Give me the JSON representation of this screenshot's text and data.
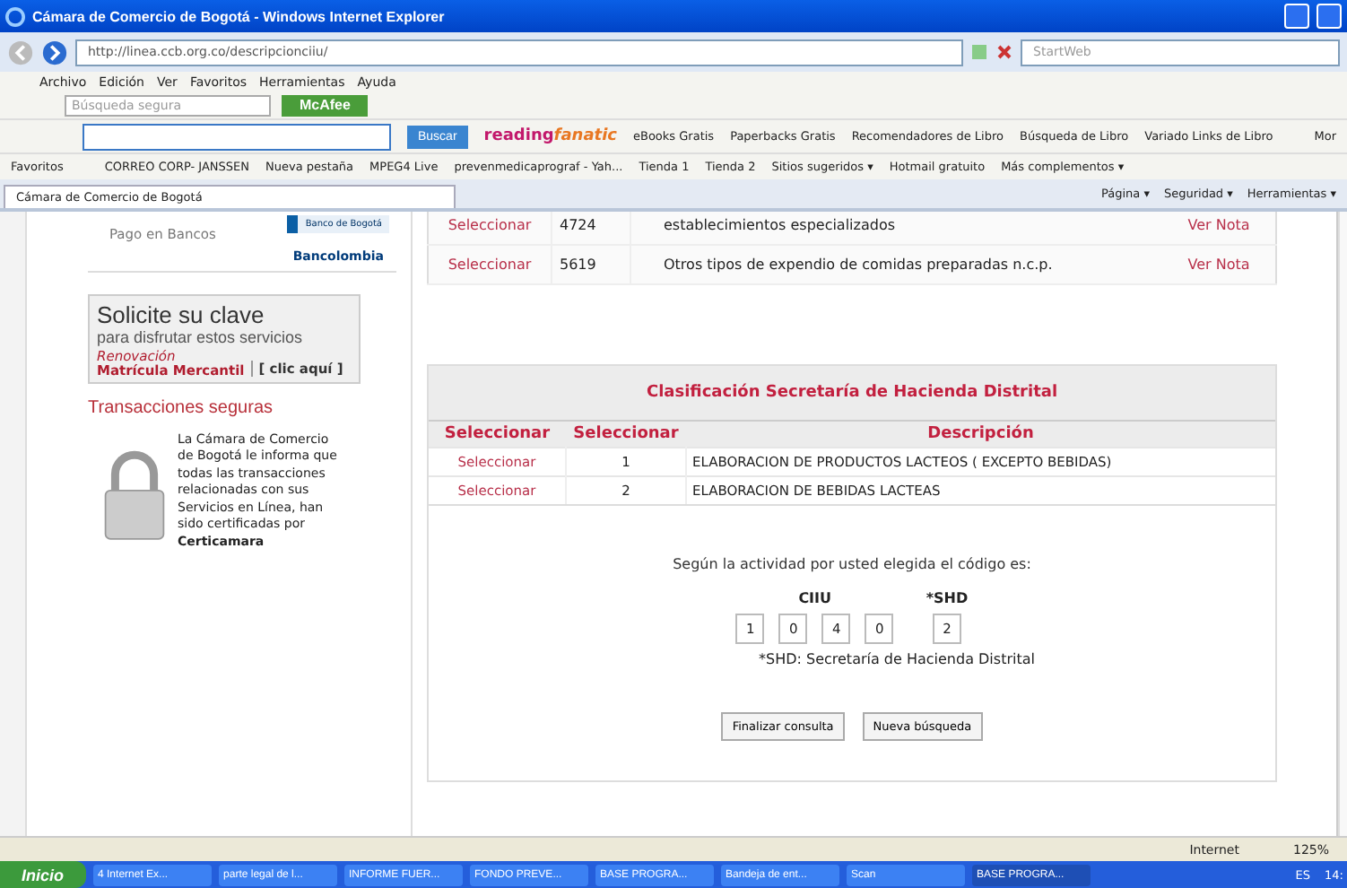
{
  "window": {
    "title": "Cámara de Comercio de Bogotá - Windows Internet Explorer"
  },
  "address_bar": {
    "url": "http://linea.ccb.org.co/descripcionciiu/",
    "search_placeholder": "StartWeb"
  },
  "menu": [
    "Archivo",
    "Edición",
    "Ver",
    "Favoritos",
    "Herramientas",
    "Ayuda"
  ],
  "mcafee_toolbar": {
    "search_placeholder": "Búsqueda segura",
    "brand": "McAfee"
  },
  "book_toolbar": {
    "button": "Buscar",
    "logo_main": "reading",
    "logo_accent": "fanatic",
    "items": [
      "eBooks Gratis",
      "Paperbacks Gratis",
      "Recomendadores de Libro",
      "Búsqueda de Libro",
      "Variado Links de Libro"
    ],
    "more": "Mor"
  },
  "favorites_bar": {
    "label": "Favoritos",
    "items": [
      "CORREO CORP- JANSSEN",
      "Nueva pestaña",
      "MPEG4 Live",
      "prevenmedicaprograf - Yah...",
      "Tienda 1",
      "Tienda 2",
      "Sitios sugeridos ▾",
      "Hotmail gratuito",
      "Más complementos ▾"
    ]
  },
  "tab": {
    "title": "Cámara de Comercio de Bogotá"
  },
  "command_bar": [
    "Página ▾",
    "Seguridad ▾",
    "Herramientas ▾"
  ],
  "sidebar": {
    "payment_label": "Pago en Bancos",
    "banks": [
      "Banco de Bogotá",
      "Bancolombia"
    ],
    "banner": {
      "title": "Solicite su clave",
      "subtitle": "para disfrutar estos servicios",
      "renewal": "Renovación",
      "renewal_strong": "Matrícula Mercantil",
      "link": "[ clic aquí ]"
    },
    "secure_heading": "Transacciones seguras",
    "secure_text": "La Cámara de Comercio de Bogotá le informa que todas las transacciones relacionadas con sus Servicios en Línea, han sido certificadas por **Certicamara**"
  },
  "activity_table": {
    "rows": [
      {
        "action": "Seleccionar",
        "code": "4724",
        "description": "establecimientos especializados",
        "note": "Ver Nota"
      },
      {
        "action": "Seleccionar",
        "code": "5619",
        "description": "Otros tipos de expendio de comidas preparadas n.c.p.",
        "note": "Ver Nota"
      }
    ]
  },
  "shd_table": {
    "title": "Clasificación Secretaría de Hacienda Distrital",
    "columns": [
      "Seleccionar",
      "Seleccionar",
      "Descripción"
    ],
    "rows": [
      {
        "action": "Seleccionar",
        "code": "1",
        "description": "ELABORACION DE PRODUCTOS LACTEOS ( EXCEPTO BEBIDAS)"
      },
      {
        "action": "Seleccionar",
        "code": "2",
        "description": "ELABORACION DE BEBIDAS LACTEAS"
      }
    ]
  },
  "result": {
    "intro": "Según la actividad por usted elegida el código es:",
    "ciiu_label": "CIIU",
    "shd_label": "*SHD",
    "ciiu_digits": [
      "1",
      "0",
      "4",
      "0"
    ],
    "shd_digits": [
      "2"
    ],
    "footnote": "*SHD: Secretaría de Hacienda Distrital",
    "buttons": [
      "Finalizar consulta",
      "Nueva búsqueda"
    ]
  },
  "status_bar": {
    "zone": "Internet",
    "zoom": "125%"
  },
  "taskbar": {
    "start": "Inicio",
    "tasks": [
      {
        "label": "4 Internet Ex...",
        "selected": false
      },
      {
        "label": "parte legal de l...",
        "selected": false
      },
      {
        "label": "INFORME FUER...",
        "selected": false
      },
      {
        "label": "FONDO PREVE...",
        "selected": false
      },
      {
        "label": "BASE PROGRA...",
        "selected": false
      },
      {
        "label": "Bandeja de ent...",
        "selected": false
      },
      {
        "label": "Scan",
        "selected": false
      },
      {
        "label": "BASE PROGRA...",
        "selected": true
      }
    ],
    "language": "ES",
    "clock": "14:"
  }
}
